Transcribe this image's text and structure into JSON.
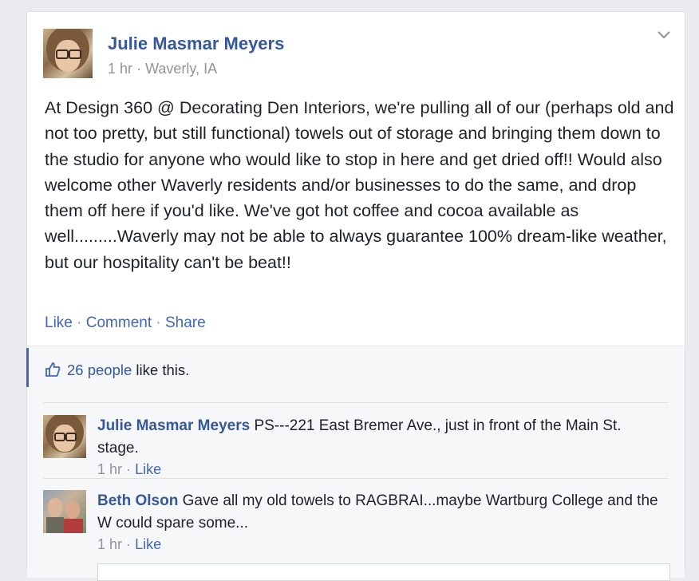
{
  "post": {
    "author": "Julie Masmar Meyers",
    "time": "1 hr",
    "dot": "·",
    "location": "Waverly, IA",
    "text": "At Design 360 @ Decorating Den Interiors, we're pulling all of our (perhaps old and not too pretty, but still functional) towels out of storage and bringing them down to the studio for anyone who would like to stop in here and get dried off!! Would also welcome other Waverly residents and/or businesses to do the same, and drop them off here if you'd like. We've got hot coffee and cocoa available as well.........Waverly may not be able to always guarantee 100% dream-like weather, but our hospitality can't be beat!!",
    "actions": {
      "like": "Like",
      "comment": "Comment",
      "share": "Share",
      "sep": "·"
    },
    "menu_icon": "chevron-down-icon"
  },
  "likes": {
    "people": "26 people",
    "suffix": " like this.",
    "icon": "thumbs-up-icon"
  },
  "comments": [
    {
      "author": "Julie Masmar Meyers",
      "text": "PS---221 East Bremer Ave., just in front of the Main St. stage.",
      "time": "1 hr",
      "dot": "·",
      "like": "Like"
    },
    {
      "author": "Beth Olson",
      "text": "Gave all my old towels to RAGBRAI...maybe Wartburg College and the W could spare some...",
      "time": "1 hr",
      "dot": "·",
      "like": "Like"
    }
  ],
  "colors": {
    "link": "#365899",
    "accent": "#4267b2",
    "muted": "#90949c",
    "text": "#1d2129"
  }
}
